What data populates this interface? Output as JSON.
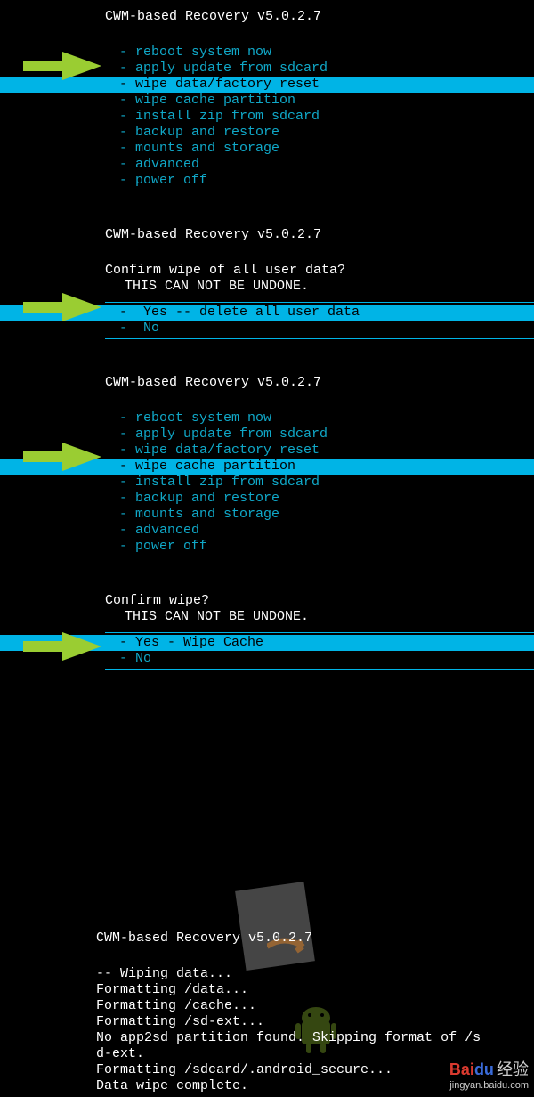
{
  "header": "CWM-based Recovery v5.0.2.7",
  "menu1": {
    "items": [
      "- reboot system now",
      "- apply update from sdcard",
      "- wipe data/factory reset",
      "- wipe cache partition",
      "- install zip from sdcard",
      "- backup and restore",
      "- mounts and storage",
      "- advanced",
      "- power off"
    ],
    "selectedIndex": 2
  },
  "confirm1": {
    "prompt": "Confirm wipe of all user data?",
    "warning": "THIS CAN NOT BE UNDONE.",
    "items": [
      "-  Yes -- delete all user data",
      "-  No"
    ],
    "selectedIndex": 0
  },
  "menu2": {
    "items": [
      "- reboot system now",
      "- apply update from sdcard",
      "- wipe data/factory reset",
      "- wipe cache partition",
      "- install zip from sdcard",
      "- backup and restore",
      "- mounts and storage",
      "- advanced",
      "- power off"
    ],
    "selectedIndex": 3
  },
  "confirm2": {
    "prompt": "Confirm wipe?",
    "warning": "THIS CAN NOT BE UNDONE.",
    "items": [
      "- Yes - Wipe Cache",
      "- No"
    ],
    "selectedIndex": 0
  },
  "log": [
    "-- Wiping data...",
    "Formatting /data...",
    "Formatting /cache...",
    "Formatting /sd-ext...",
    "No app2sd partition found. Skipping format of /s",
    "d-ext.",
    "Formatting /sdcard/.android_secure...",
    "Data wipe complete."
  ],
  "baidu": {
    "brand1": "Bai",
    "brand2": "du",
    "cn": "经验",
    "url": "jingyan.baidu.com"
  }
}
